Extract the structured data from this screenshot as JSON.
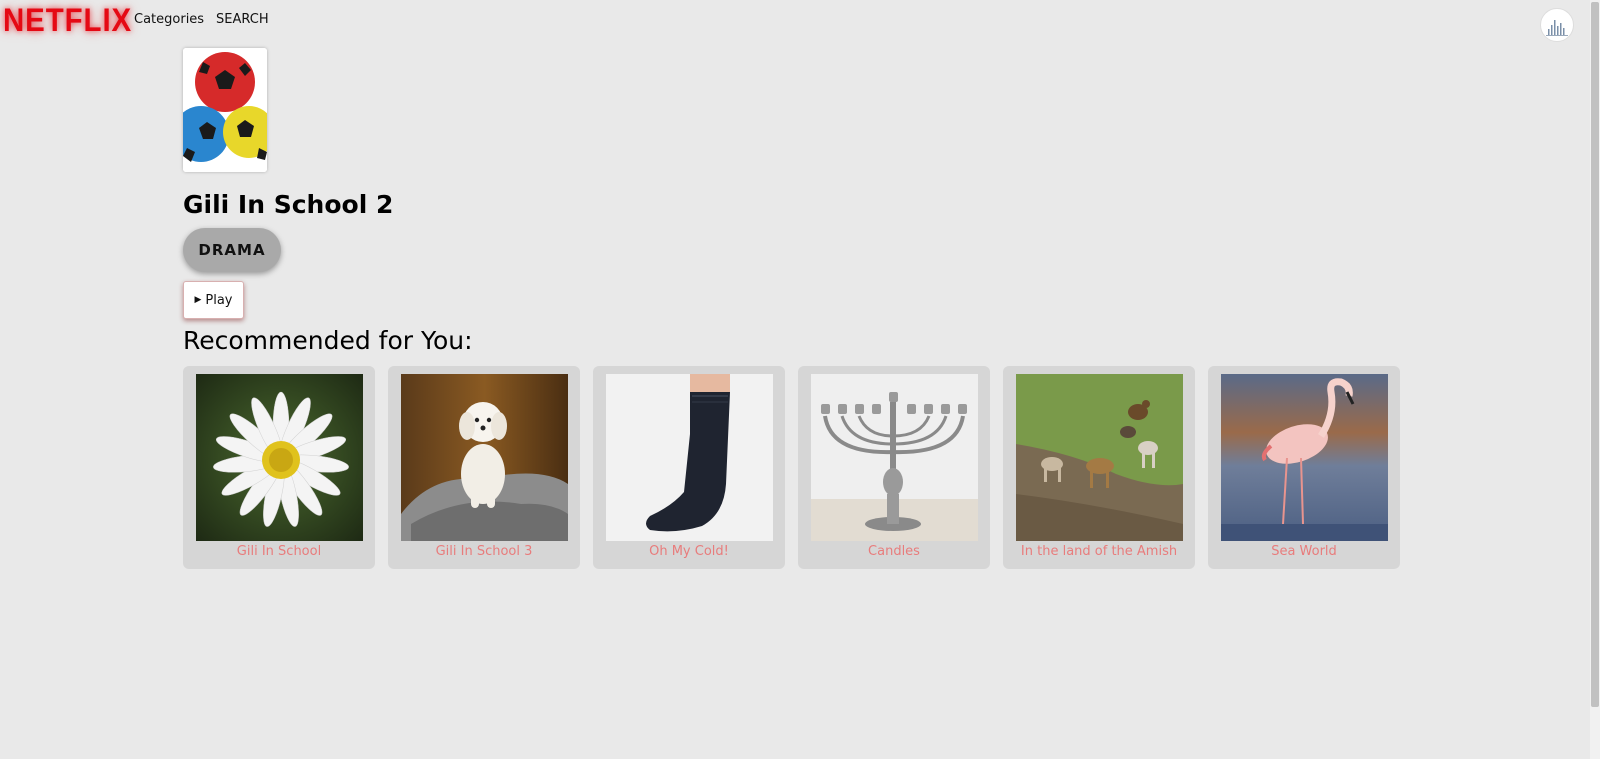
{
  "header": {
    "logo": "NETFLIX",
    "nav": {
      "categories": "Categories",
      "search": "SEARCH"
    }
  },
  "movie": {
    "title": "Gili In School 2",
    "genre": "DRAMA",
    "play_label": "Play",
    "play_icon": "play-triangle-icon"
  },
  "recommendations": {
    "heading": "Recommended for You:",
    "items": [
      {
        "title": "Gili In School",
        "image": "daisy-flower"
      },
      {
        "title": "Gili In School 3",
        "image": "white-puppy-on-rock"
      },
      {
        "title": "Oh My Cold!",
        "image": "black-sock"
      },
      {
        "title": "Candles",
        "image": "silver-menorah"
      },
      {
        "title": "In the land of the Amish",
        "image": "chickens-and-goats"
      },
      {
        "title": "Sea World",
        "image": "flamingo"
      }
    ]
  },
  "colors": {
    "background": "#e9e9e9",
    "logo": "#e50914",
    "card": "#d6d6d6",
    "card_label": "#e87c7c",
    "genre_pill": "#a9a9a9"
  }
}
